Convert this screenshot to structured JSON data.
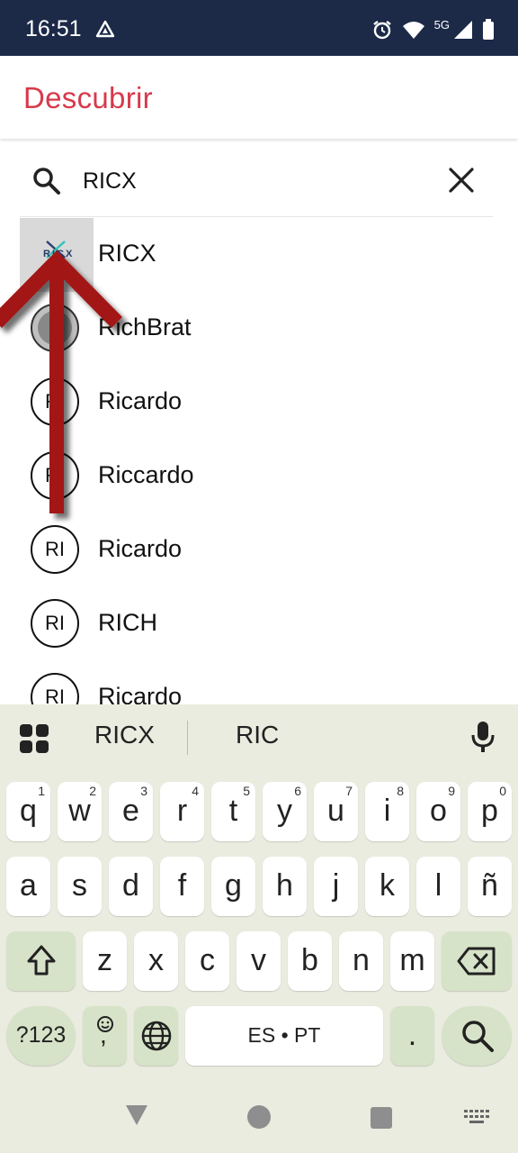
{
  "status_bar": {
    "time": "16:51",
    "network": "5G",
    "icons": [
      "triangle-app-icon",
      "alarm-icon",
      "wifi-icon",
      "signal-icon",
      "battery-icon"
    ]
  },
  "app_bar": {
    "title": "Descubrir",
    "title_color": "#d8394b"
  },
  "search": {
    "value": "RICX",
    "icons": [
      "search-icon",
      "close-icon"
    ]
  },
  "results": [
    {
      "name": "RICX",
      "avatar": "logo",
      "logo_text": "RICX"
    },
    {
      "name": "RichBrat",
      "avatar": "image"
    },
    {
      "name": "Ricardo",
      "avatar": "initials",
      "initials": "RI"
    },
    {
      "name": "Riccardo",
      "avatar": "initials",
      "initials": "RI"
    },
    {
      "name": "Ricardo",
      "avatar": "initials",
      "initials": "RI"
    },
    {
      "name": "RICH",
      "avatar": "initials",
      "initials": "RI"
    },
    {
      "name": "Ricardo",
      "avatar": "initials",
      "initials": "RI"
    }
  ],
  "keyboard": {
    "suggestions": [
      "RICX",
      "RIC"
    ],
    "row1": [
      {
        "k": "q",
        "n": "1"
      },
      {
        "k": "w",
        "n": "2"
      },
      {
        "k": "e",
        "n": "3"
      },
      {
        "k": "r",
        "n": "4"
      },
      {
        "k": "t",
        "n": "5"
      },
      {
        "k": "y",
        "n": "6"
      },
      {
        "k": "u",
        "n": "7"
      },
      {
        "k": "i",
        "n": "8"
      },
      {
        "k": "o",
        "n": "9"
      },
      {
        "k": "p",
        "n": "0"
      }
    ],
    "row2": [
      "a",
      "s",
      "d",
      "f",
      "g",
      "h",
      "j",
      "k",
      "l",
      "ñ"
    ],
    "row3": [
      "z",
      "x",
      "c",
      "v",
      "b",
      "n",
      "m"
    ],
    "symbols_label": "?123",
    "emoji_comma": ",",
    "space_label": "ES • PT",
    "period": "."
  },
  "colors": {
    "status_bar_bg": "#1c2a48",
    "keyboard_bg": "#e9ecdf",
    "accent_key": "#d7e3c8",
    "arrow": "#a31515"
  }
}
